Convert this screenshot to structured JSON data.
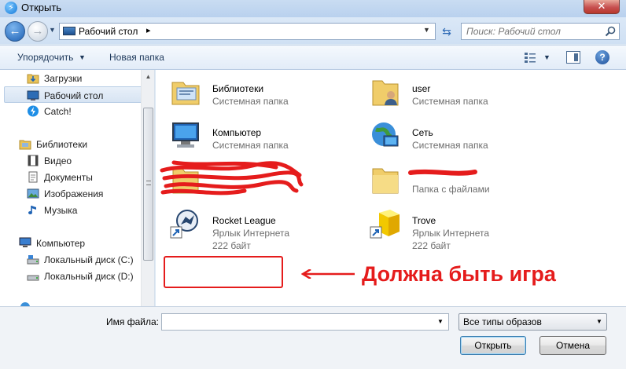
{
  "window": {
    "title": "Открыть",
    "close_glyph": "✕"
  },
  "address": {
    "path": "Рабочий стол",
    "separator": "▸",
    "search_placeholder": "Поиск: Рабочий стол"
  },
  "toolbar": {
    "organize": "Упорядочить",
    "new_folder": "Новая папка",
    "help": "?"
  },
  "nav": {
    "favorites": [
      {
        "label": "Загрузки",
        "icon": "downloads-folder-icon"
      },
      {
        "label": "Рабочий стол",
        "icon": "desktop-icon",
        "selected": true
      },
      {
        "label": "Catch!",
        "icon": "catch-app-icon"
      }
    ],
    "libraries_label": "Библиотеки",
    "libraries": [
      {
        "label": "Видео",
        "icon": "video-library-icon"
      },
      {
        "label": "Документы",
        "icon": "documents-library-icon"
      },
      {
        "label": "Изображения",
        "icon": "pictures-library-icon"
      },
      {
        "label": "Музыка",
        "icon": "music-library-icon"
      }
    ],
    "computer_label": "Компьютер",
    "drives": [
      {
        "label": "Локальный диск (C:)",
        "icon": "drive-c-icon"
      },
      {
        "label": "Локальный диск (D:)",
        "icon": "drive-d-icon"
      }
    ]
  },
  "files": [
    {
      "name": "Библиотеки",
      "type": "Системная папка",
      "icon": "libraries-folder-icon"
    },
    {
      "name": "user",
      "type": "Системная папка",
      "icon": "user-folder-icon"
    },
    {
      "name": "Компьютер",
      "type": "Системная папка",
      "icon": "computer-icon"
    },
    {
      "name": "Сеть",
      "type": "Системная папка",
      "icon": "network-icon"
    },
    {
      "name": "",
      "type": "",
      "icon": "folder-icon",
      "redacted": true
    },
    {
      "name": "",
      "type": "Папка с файлами",
      "icon": "folder-icon",
      "redacted": true
    },
    {
      "name": "Rocket League",
      "type": "Ярлык Интернета",
      "size": "222 байт",
      "icon": "rocket-league-icon"
    },
    {
      "name": "Trove",
      "type": "Ярлык Интернета",
      "size": "222 байт",
      "icon": "trove-icon"
    }
  ],
  "annotation": {
    "text": "Должна быть игра",
    "color": "#e51c1c"
  },
  "bottom": {
    "filename_label": "Имя файла:",
    "filename_value": "",
    "filter": "Все типы образов",
    "open": "Открыть",
    "cancel": "Отмена"
  },
  "colors": {
    "accent": "#1b5fb3",
    "annotation_red": "#e51c1c",
    "selected_bg": "#d7e4f3"
  }
}
